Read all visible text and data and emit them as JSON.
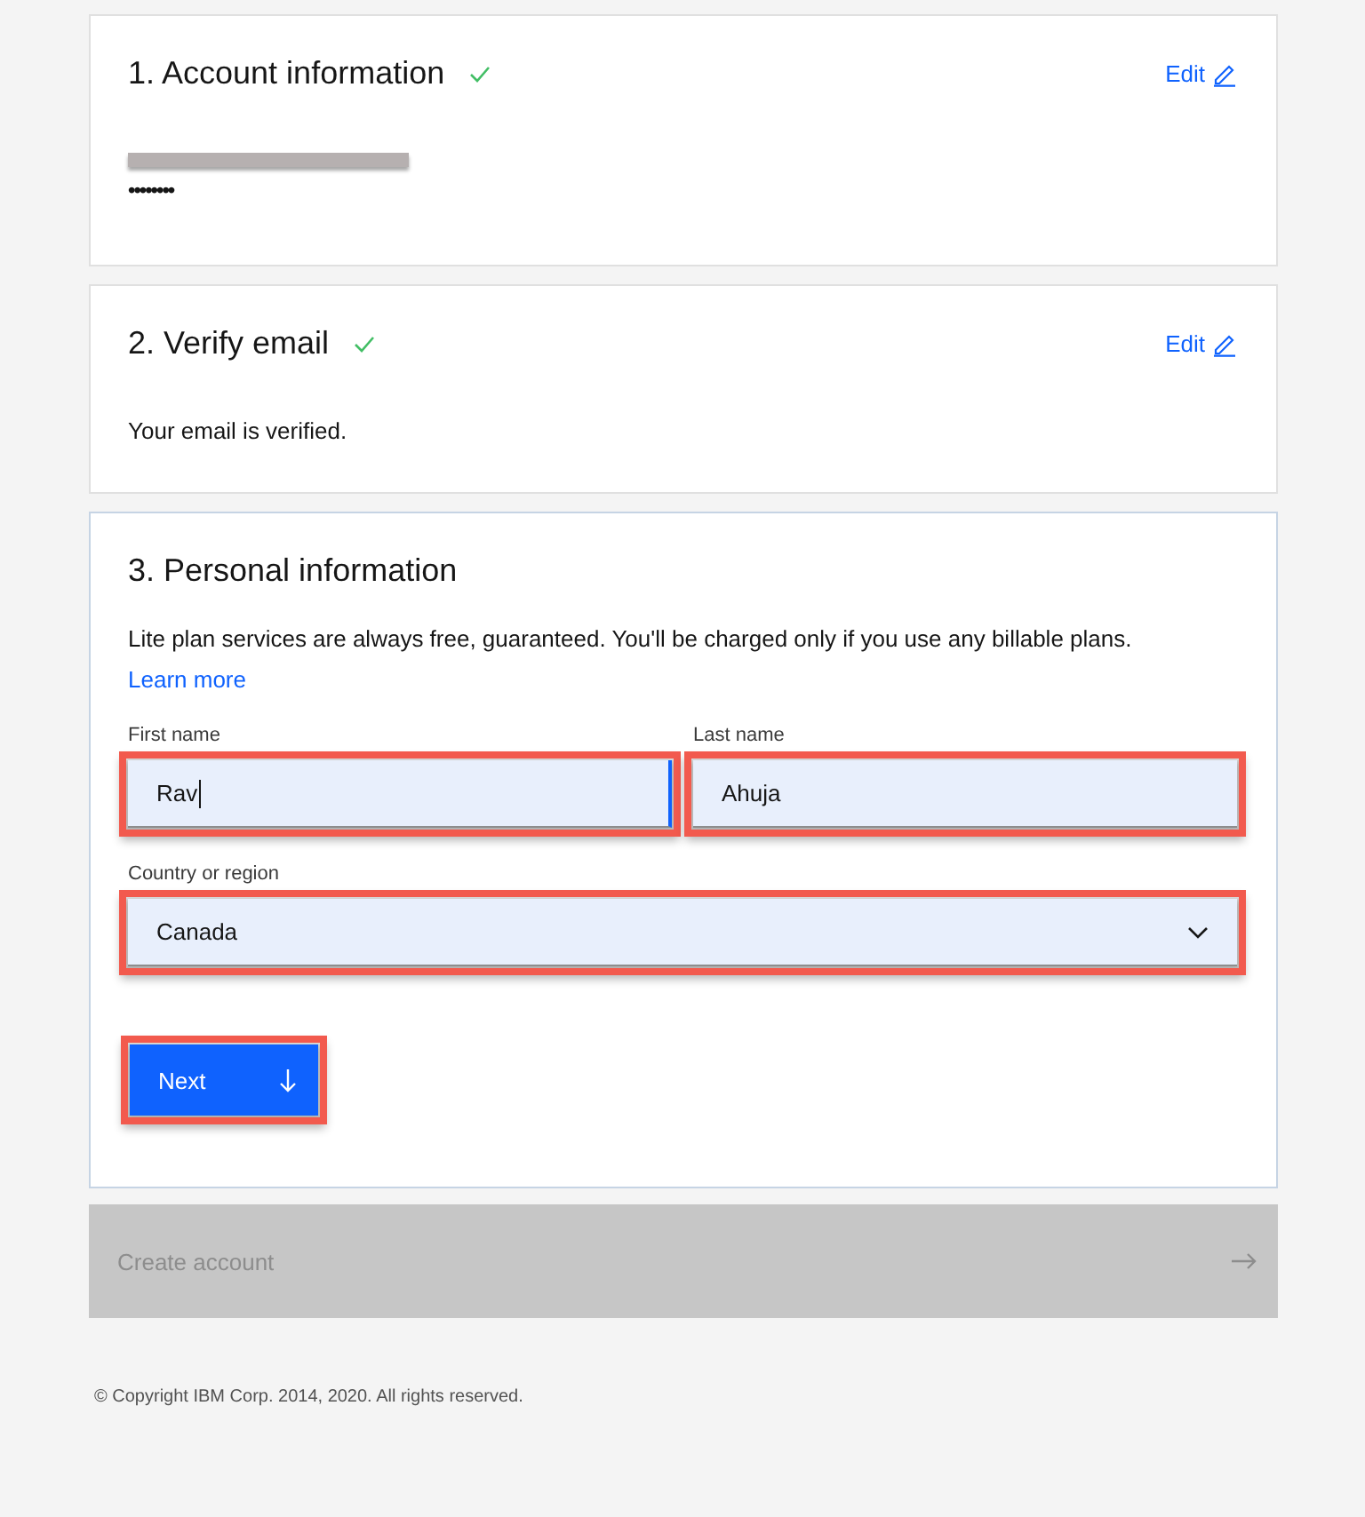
{
  "steps": [
    {
      "title": "1. Account information",
      "completed": true,
      "edit_label": "Edit",
      "kind": "account",
      "redacted_email": true,
      "password_mask": "••••••••"
    },
    {
      "title": "2. Verify email",
      "completed": true,
      "edit_label": "Edit",
      "kind": "message",
      "message": "Your email is verified."
    }
  ],
  "personal": {
    "title": "3. Personal information",
    "notice": "Lite plan services are always free, guaranteed. You'll be charged only if you use any billable plans.",
    "link": "Learn more",
    "first_name": {
      "label": "First name",
      "value": "Rav",
      "focused": true,
      "highlighted": true
    },
    "last_name": {
      "label": "Last name",
      "value": "Ahuja",
      "focused": false,
      "highlighted": true
    },
    "country": {
      "label": "Country or region",
      "value": "Canada",
      "highlighted": true
    },
    "next_button": {
      "label": "Next",
      "highlighted": true
    }
  },
  "create_account": {
    "label": "Create account",
    "disabled": true
  },
  "footer": "© Copyright IBM Corp. 2014, 2020. All rights reserved."
}
